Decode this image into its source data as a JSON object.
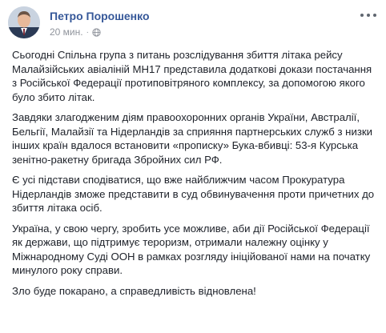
{
  "post": {
    "author": "Петро Порошенко",
    "time": "20 мин.",
    "separator": "·",
    "privacy_icon": "globe-icon",
    "more_icon": "more-options-icon",
    "paragraphs": [
      "Сьогодні Спільна група з питань розслідування збиття літака рейсу Малайзійських авіаліній МН17 представила додаткові докази постачання з Російської Федерації протиповітряного комплексу, за допомогою якого було збито літак.",
      "Завдяки злагодженим діям правоохоронних органів України, Австралії, Бельгії, Малайзії та Нідерландів за сприяння партнерських служб з низки інших країн вдалося встановити «прописку» Бука-вбивці: 53-я Курська зенітно-ракетну бригада Збройних сил РФ.",
      "Є усі підстави сподіватися, що вже найближчим часом Прокуратура Нідерландів зможе представити в суд обвинувачення проти причетних до збиття літака осіб.",
      "Україна, у свою чергу, зробить усе можливе, аби дії Російської Федерації як держави, що підтримує тероризм, отримали належну оцінку у Міжнародному Суді ООН в рамках розгляду ініційованої нами на початку минулого року справи.",
      "Зло буде покарано, а справедливість відновлена!"
    ]
  }
}
